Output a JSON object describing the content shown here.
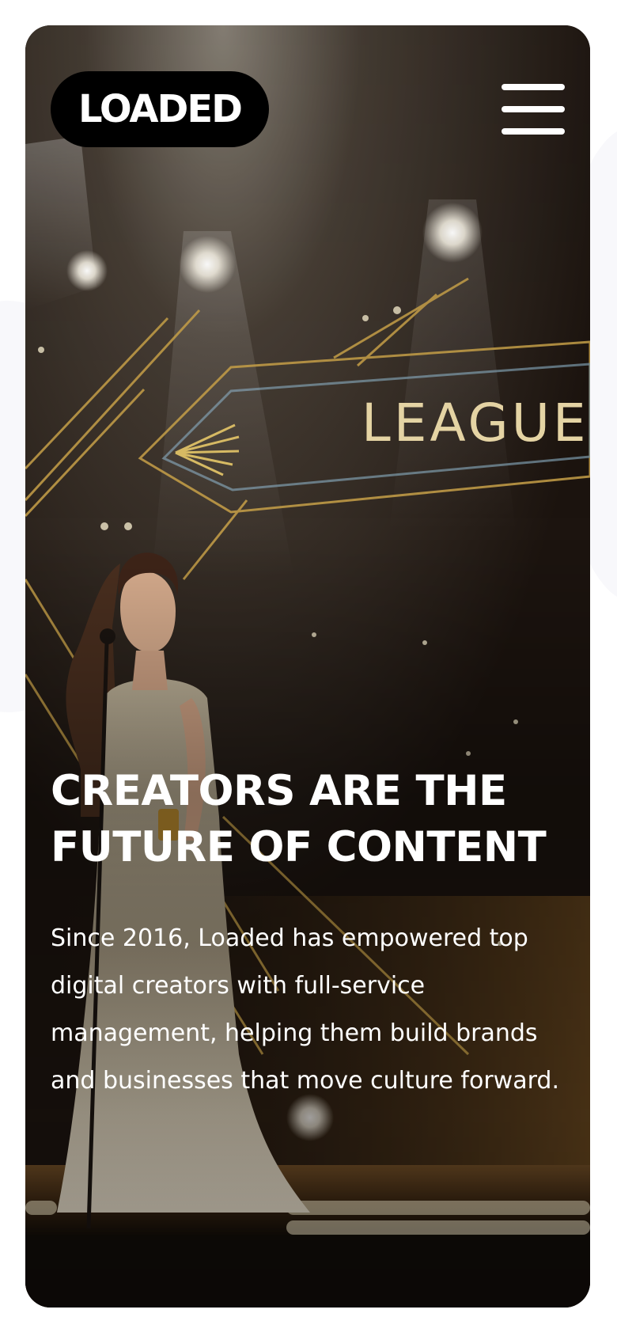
{
  "brand": {
    "logo_text": "LOADED"
  },
  "nav": {
    "menu_icon": "hamburger-menu-icon"
  },
  "hero": {
    "headline_line1": "CREATORS ARE THE",
    "headline_line2": "FUTURE OF CONTENT",
    "body": "Since 2016, Loaded has empowered top digital creators with full-service management, helping them build brands and businesses that move culture forward.",
    "photo_sign_text": "LEAGUE C"
  },
  "colors": {
    "background": "#ffffff",
    "logo_pill": "#000000",
    "text": "#ffffff",
    "stage_gold": "#c9a24a",
    "stage_dark": "#1c140f"
  }
}
